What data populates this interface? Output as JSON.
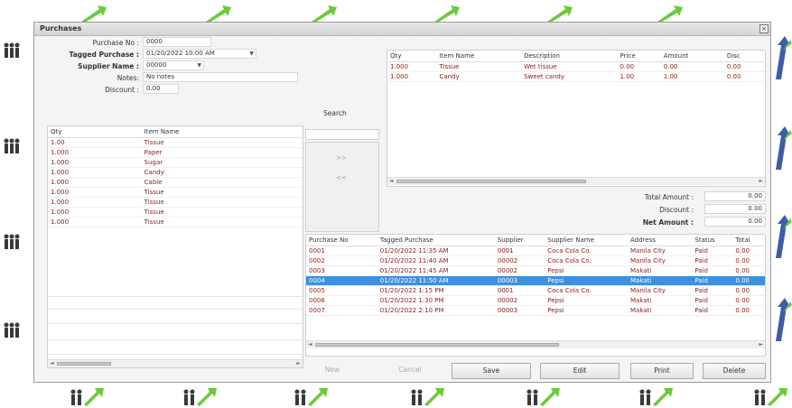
{
  "window": {
    "title": "Purchases",
    "close_glyph": "×"
  },
  "form": {
    "purchase_no_label": "Purchase No :",
    "purchase_no_value": "0000",
    "tagged_date_label": "Tagged Purchase :",
    "tagged_date_value": "01/20/2022 10:00 AM",
    "supplier_label": "Supplier Name :",
    "supplier_value": "00000",
    "notes_label": "Notes:",
    "notes_value": "No notes",
    "discount_label": "Discount :",
    "discount_value": "0.00"
  },
  "items_grid": {
    "columns": [
      "Qty",
      "Item Name"
    ],
    "rows": [
      [
        "1.00",
        "Tissue"
      ],
      [
        "1.000",
        "Paper"
      ],
      [
        "1.000",
        "Sugar"
      ],
      [
        "1.000",
        "Candy"
      ],
      [
        "1.000",
        "Cable"
      ],
      [
        "1.000",
        "Tissue"
      ],
      [
        "1.000",
        "Tissue"
      ],
      [
        "1.000",
        "Tissue"
      ],
      [
        "1.000",
        "Tissue"
      ]
    ]
  },
  "middle": {
    "search_label": "Search",
    "btn1": ">>",
    "btn2": "<<"
  },
  "detail_grid": {
    "columns": [
      "Qty",
      "Item Name",
      "Description",
      "Price",
      "Amount",
      "Disc"
    ],
    "rows": [
      [
        "1.000",
        "Tissue",
        "Wet tissue",
        "0.00",
        "0.00",
        "0.00"
      ],
      [
        "1.000",
        "Candy",
        "Sweet candy",
        "1.00",
        "1.00",
        "0.00"
      ]
    ]
  },
  "totals": {
    "gross_label": "Total Amount :",
    "gross_value": "0.00",
    "discount_label": "Discount :",
    "discount_value": "0.00",
    "net_label": "Net Amount :",
    "net_value": "0.00"
  },
  "list_grid": {
    "columns": [
      "Purchase No",
      "Tagged Purchase",
      "Supplier",
      "Supplier Name",
      "Address",
      "Status",
      "Total"
    ],
    "rows": [
      [
        "0001",
        "01/20/2022 11:35 AM",
        "0001",
        "Coca Cola Co.",
        "Manila City",
        "Paid",
        "0.00"
      ],
      [
        "0002",
        "01/20/2022 11:40 AM",
        "00002",
        "Coca Cola Co.",
        "Manila City",
        "Paid",
        "0.00"
      ],
      [
        "0003",
        "01/20/2022 11:45 AM",
        "00002",
        "Pepsi",
        "Makati",
        "Paid",
        "0.00"
      ],
      [
        "0004",
        "01/20/2022 11:50 AM",
        "00003",
        "Pepsi",
        "Makati",
        "Paid",
        "0.00"
      ],
      [
        "0005",
        "01/20/2022 1:15 PM",
        "0001",
        "Coca Cola Co.",
        "Manila City",
        "Paid",
        "0.00"
      ],
      [
        "0006",
        "01/20/2022 1:30 PM",
        "00002",
        "Pepsi",
        "Makati",
        "Paid",
        "0.00"
      ],
      [
        "0007",
        "01/20/2022 2:10 PM",
        "00003",
        "Pepsi",
        "Makati",
        "Paid",
        "0.00"
      ]
    ],
    "selected_index": 3
  },
  "buttons": {
    "new": "New",
    "cancel": "Cancel",
    "save": "Save",
    "edit": "Edit",
    "print": "Print",
    "delete": "Delete"
  },
  "colors": {
    "selection": "#3d8fe0",
    "value_text": "#8a1c1c"
  }
}
